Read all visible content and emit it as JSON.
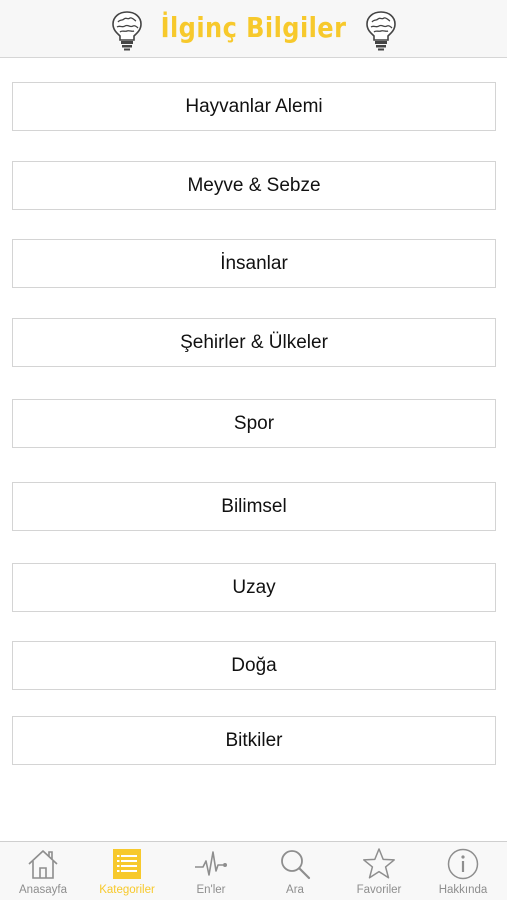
{
  "header": {
    "title": "İlginç Bilgiler",
    "left_icon": "brain-lightbulb-icon",
    "right_icon": "brain-lightbulb-icon",
    "title_color": "#f7c92c"
  },
  "categories": [
    {
      "label": "Hayvanlar Alemi"
    },
    {
      "label": "Meyve & Sebze"
    },
    {
      "label": "İnsanlar"
    },
    {
      "label": "Şehirler & Ülkeler"
    },
    {
      "label": "Spor"
    },
    {
      "label": "Bilimsel"
    },
    {
      "label": "Uzay"
    },
    {
      "label": "Doğa"
    },
    {
      "label": "Bitkiler"
    }
  ],
  "tabbar": {
    "active_color": "#f7c92c",
    "inactive_color": "#8e8e8e",
    "items": [
      {
        "label": "Anasayfa",
        "icon": "home-icon",
        "active": false
      },
      {
        "label": "Kategoriler",
        "icon": "list-icon",
        "active": true
      },
      {
        "label": "En'ler",
        "icon": "heartbeat-icon",
        "active": false
      },
      {
        "label": "Ara",
        "icon": "search-icon",
        "active": false
      },
      {
        "label": "Favoriler",
        "icon": "star-icon",
        "active": false
      },
      {
        "label": "Hakkında",
        "icon": "info-icon",
        "active": false
      }
    ]
  }
}
